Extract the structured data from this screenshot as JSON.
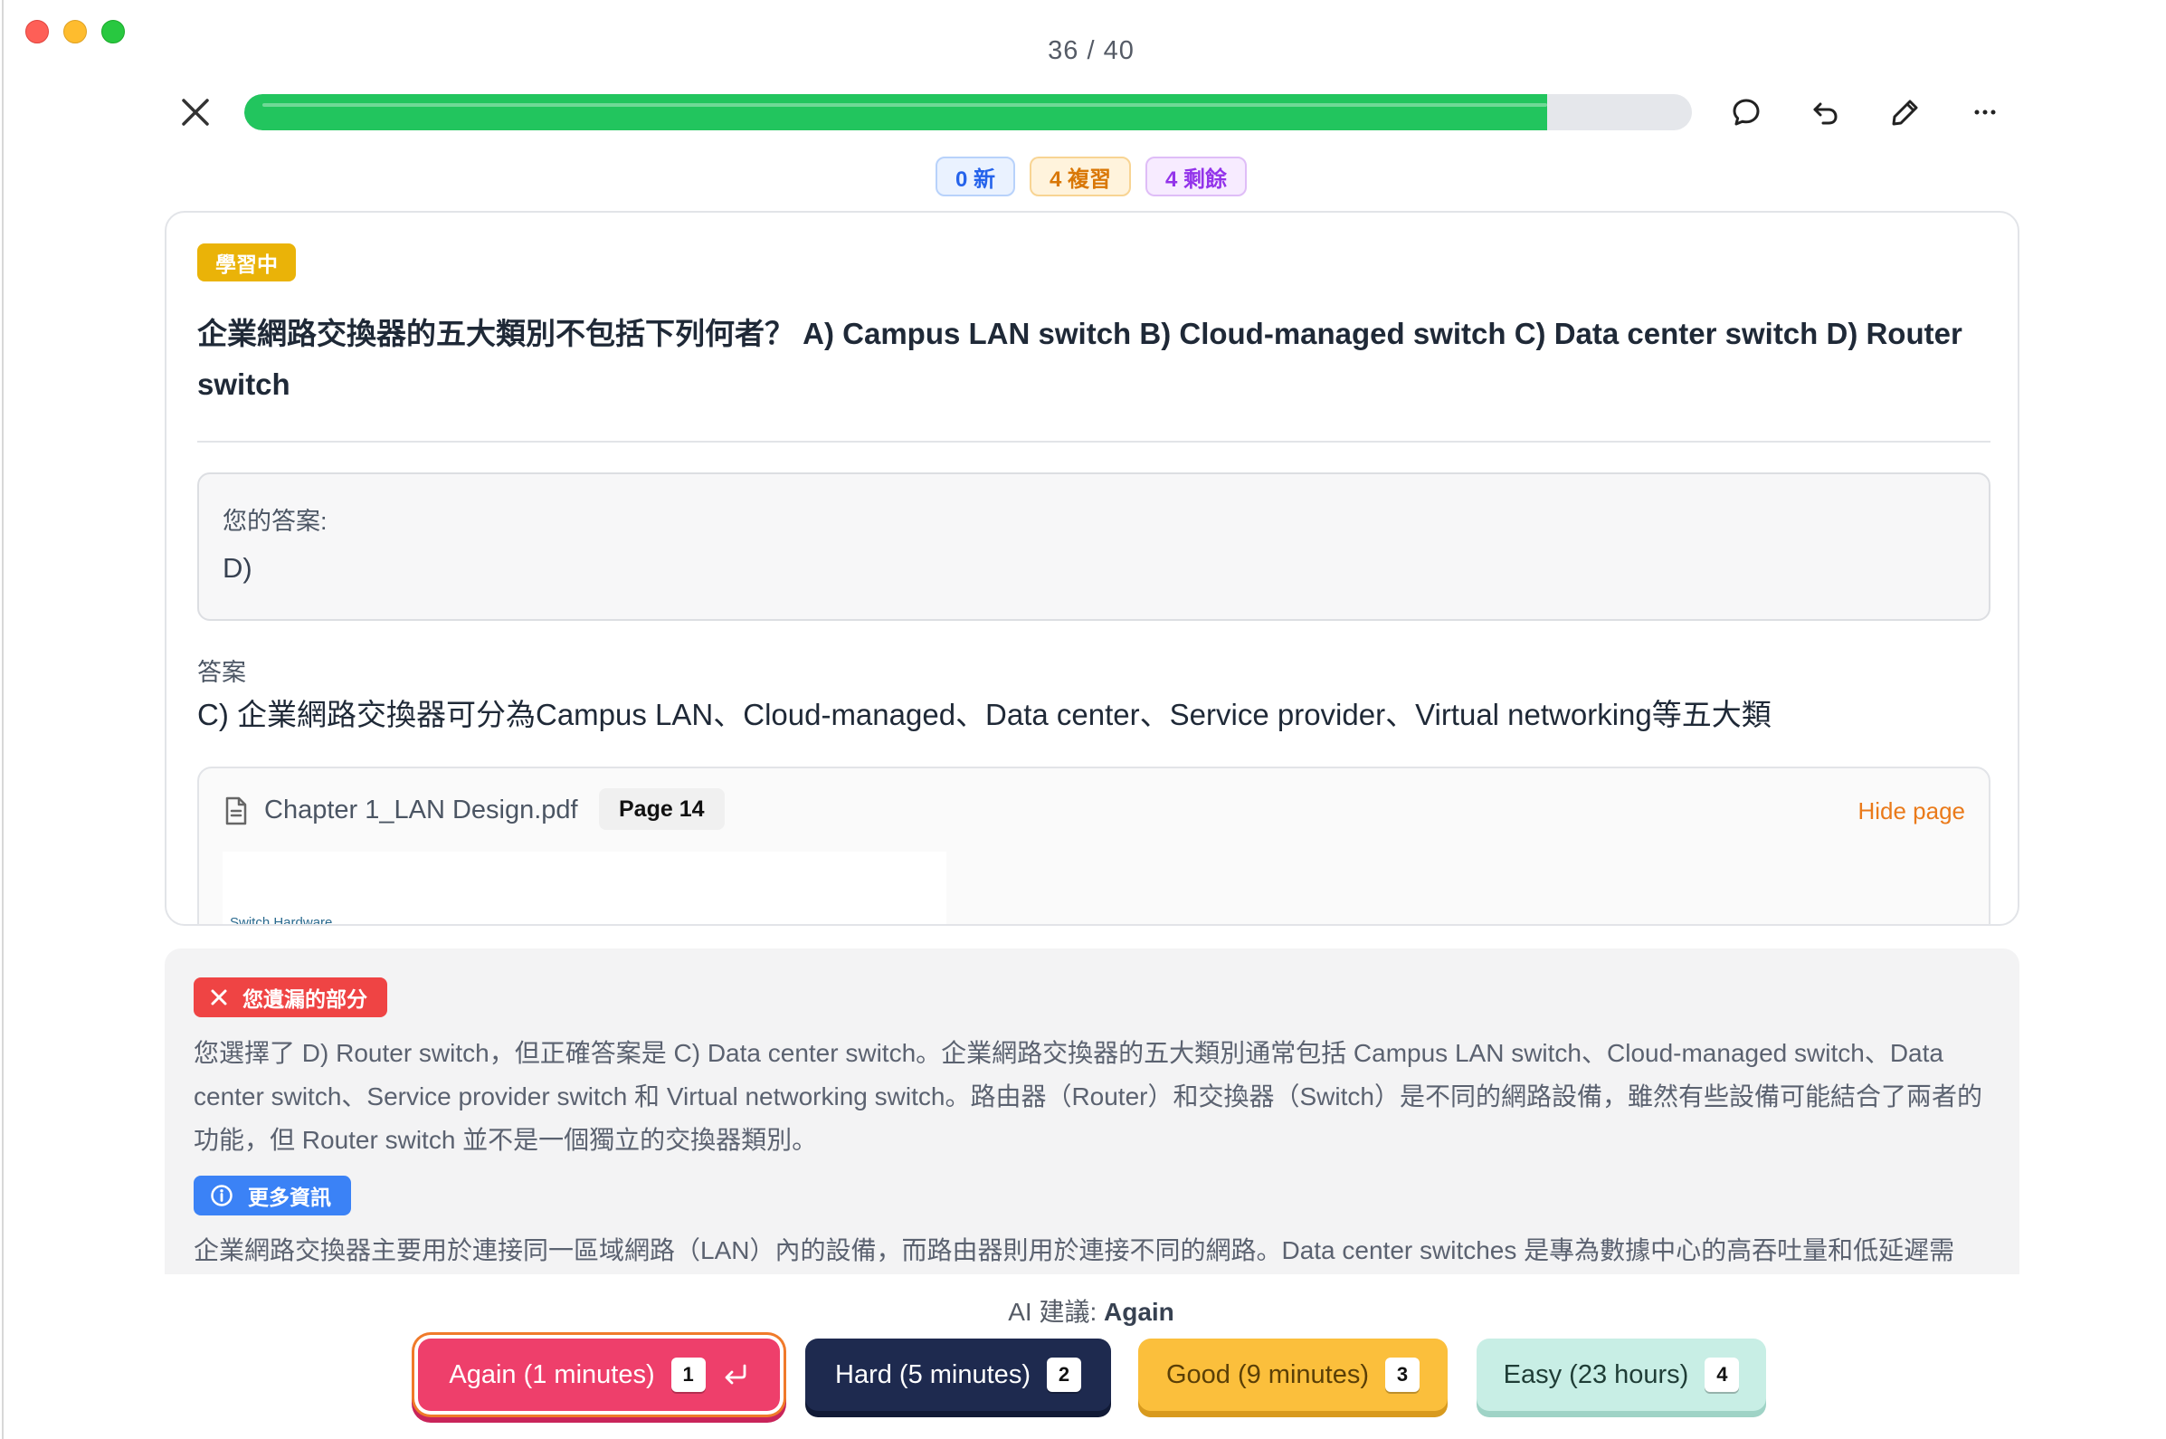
{
  "header": {
    "counter": "36 / 40",
    "progress_fraction": 0.9
  },
  "stats": {
    "new": "0 新",
    "review": "4 複習",
    "remaining": "4 剩餘"
  },
  "card": {
    "status_badge": "學習中",
    "question": "企業網路交換器的五大類別不包括下列何者？ A) Campus LAN switch B) Cloud-managed switch C) Data center switch D) Router switch",
    "your_answer_label": "您的答案:",
    "your_answer_value": "D)",
    "answer_label": "答案",
    "answer_text": "C) 企業網路交換器可分為Campus LAN、Cloud-managed、Data center、Service provider、Virtual networking等五大類",
    "source": {
      "file_name": "Chapter 1_LAN Design.pdf",
      "page": "Page 14",
      "hide_label": "Hide page",
      "thumb_title": "Switch Hardware"
    }
  },
  "feedback": {
    "missed_label": "您遺漏的部分",
    "missed_text": "您選擇了 D) Router switch，但正確答案是 C) Data center switch。企業網路交換器的五大類別通常包括 Campus LAN switch、Cloud-managed switch、Data center switch、Service provider switch 和 Virtual networking switch。路由器（Router）和交換器（Switch）是不同的網路設備，雖然有些設備可能結合了兩者的功能，但 Router switch 並不是一個獨立的交換器類別。",
    "more_label": "更多資訊",
    "more_text": "企業網路交換器主要用於連接同一區域網路（LAN）內的設備，而路由器則用於連接不同的網路。Data center switches 是專為數據中心的高吞吐量和低延遲需"
  },
  "ai_suggestion": {
    "prefix": "AI 建議:",
    "value": "Again"
  },
  "answer_buttons": [
    {
      "label": "Again (1 minutes)",
      "key": "1"
    },
    {
      "label": "Hard (5 minutes)",
      "key": "2"
    },
    {
      "label": "Good (9 minutes)",
      "key": "3"
    },
    {
      "label": "Easy (23 hours)",
      "key": "4"
    }
  ],
  "colors": {
    "progress": "#22c55e",
    "again": "#ee3f6b",
    "hard": "#1e2a4f",
    "good": "#fbbf3c",
    "easy": "#c8eee5",
    "learning_badge": "#eab308",
    "missed_badge": "#ef4444",
    "more_badge": "#3b82f6",
    "hide_link": "#ea7a1a"
  },
  "icons": [
    "close-icon",
    "comment-icon",
    "undo-icon",
    "edit-icon",
    "more-icon",
    "document-icon",
    "x-icon",
    "info-icon",
    "enter-icon"
  ]
}
